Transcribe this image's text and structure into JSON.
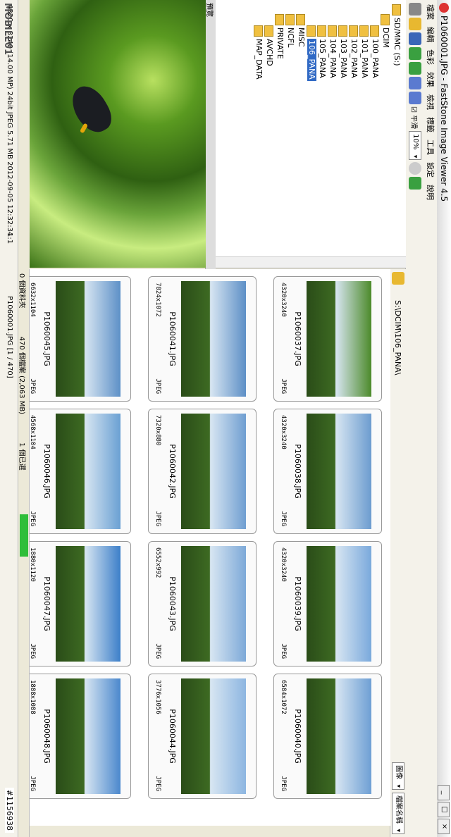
{
  "window": {
    "title": "P1060001.JPG - FastStone Image Viewer 4.5"
  },
  "menu": [
    "檔案",
    "編輯",
    "色彩",
    "效果",
    "檢視",
    "標籤",
    "工具",
    "設定",
    "說明"
  ],
  "toolbar": {
    "zoom_value": "10%",
    "smooth_label": "平滑"
  },
  "tree": {
    "root": "SD/MMC (S:)",
    "items": [
      "DCIM",
      "100_PANA",
      "101_PANA",
      "102_PANA",
      "103_PANA",
      "104_PANA",
      "105_PANA",
      "106_PANA",
      "MISC",
      "NCFL",
      "PRIVATE",
      "AVCHD",
      "MAP_DATA"
    ],
    "selected": "106_PANA"
  },
  "preview": {
    "header": "預覽"
  },
  "pathbar": {
    "path": "S:\\DCIM\\106_PANA\\",
    "sort_label": "檔案名稱",
    "view_label": "圖像"
  },
  "thumbs": [
    {
      "name": "P1060037.JPG",
      "dims": "4320x3240",
      "type": "JPEG",
      "color": "#4c8a2a"
    },
    {
      "name": "P1060038.JPG",
      "dims": "4320x3240",
      "type": "JPEG",
      "color": "#6c9ccf"
    },
    {
      "name": "P1060039.JPG",
      "dims": "4320x3240",
      "type": "JPEG",
      "color": "#7aa9dc"
    },
    {
      "name": "P1060040.JPG",
      "dims": "6584x1072",
      "type": "JPEG",
      "color": "#6e9fd4"
    },
    {
      "name": "P1060041.JPG",
      "dims": "7824x1072",
      "type": "JPEG",
      "color": "#5d8fc6"
    },
    {
      "name": "P1060042.JPG",
      "dims": "7320x880",
      "type": "JPEG",
      "color": "#6f9ed1"
    },
    {
      "name": "P1060043.JPG",
      "dims": "6552x992",
      "type": "JPEG",
      "color": "#7da9d8"
    },
    {
      "name": "P1060044.JPG",
      "dims": "3776x1056",
      "type": "JPEG",
      "color": "#8db6e1"
    },
    {
      "name": "P1060045.JPG",
      "dims": "6632x1104",
      "type": "JPEG",
      "color": "#5d90c7"
    },
    {
      "name": "P1060046.JPG",
      "dims": "4568x1104",
      "type": "JPEG",
      "color": "#6aa0d3"
    },
    {
      "name": "P1060047.JPG",
      "dims": "1880x1120",
      "type": "JPEG",
      "color": "#3c7fc9"
    },
    {
      "name": "P1060048.JPG",
      "dims": "1888x1088",
      "type": "JPEG",
      "color": "#4b88cd"
    }
  ],
  "status": {
    "folders": "0 個資料夾",
    "files": "470 個檔案 (2,063 MB)",
    "selected": "1 個已選"
  },
  "bottom": {
    "info": "4320 x 3240 (14.00 MP)  24bit  JPEG  5.71 MB  2012-09-05 12:32:34",
    "file": "P1060001.JPG [1 / 470]",
    "zoom": "1:1"
  },
  "watermark": "MOBILE01",
  "credit": "#1156938"
}
